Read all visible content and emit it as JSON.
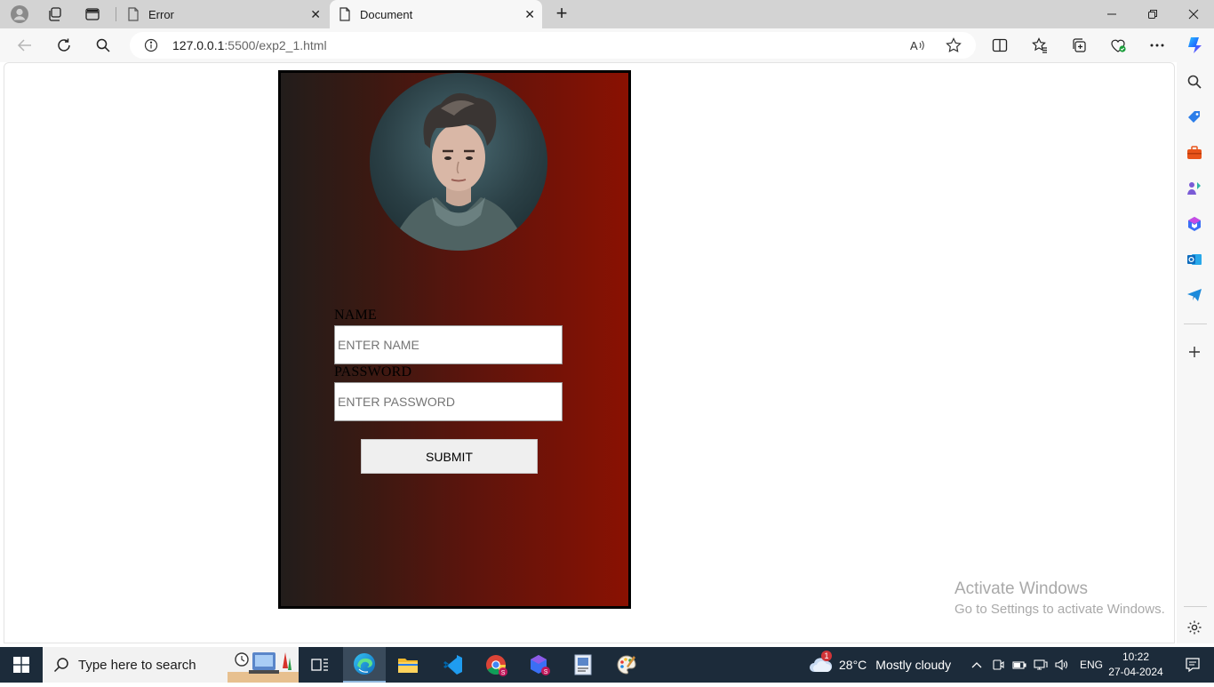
{
  "browser": {
    "tabs": [
      {
        "title": "Error",
        "active": false
      },
      {
        "title": "Document",
        "active": true
      }
    ],
    "url_host": "127.0.0.1",
    "url_rest": ":5500/exp2_1.html"
  },
  "form": {
    "name_label": "NAME",
    "name_placeholder": "ENTER NAME",
    "password_label": "PASSWORD",
    "password_placeholder": "ENTER PASSWORD",
    "submit_label": "SUBMIT"
  },
  "watermark": {
    "title": "Activate Windows",
    "subtitle": "Go to Settings to activate Windows."
  },
  "taskbar": {
    "search_placeholder": "Type here to search",
    "weather_temp": "28°C",
    "weather_text": "Mostly cloudy",
    "weather_badge": "1",
    "language": "ENG",
    "time": "10:22",
    "date": "27-04-2024"
  },
  "colors": {
    "card_gradient_start": "#221d1b",
    "card_gradient_end": "#8a1102",
    "taskbar": "#1c2b3a",
    "edge_accent": "#0f6cbd"
  }
}
